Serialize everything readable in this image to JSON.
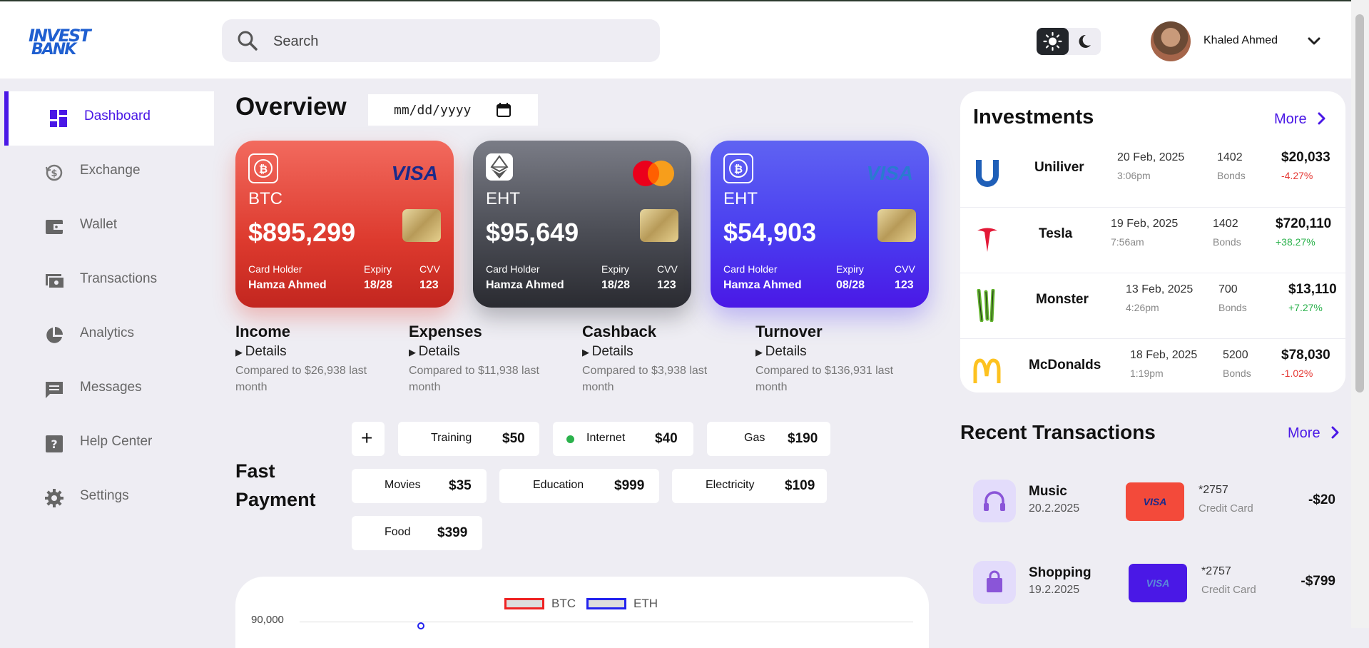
{
  "brand": {
    "logo_line1": "INVEST",
    "logo_line2": "BANK"
  },
  "search": {
    "placeholder": "Search"
  },
  "user": {
    "name": "Khaled Ahmed"
  },
  "sidebar": {
    "items": [
      {
        "label": "Dashboard",
        "icon": "dashboard-icon",
        "active": true
      },
      {
        "label": "Exchange",
        "icon": "exchange-icon"
      },
      {
        "label": "Wallet",
        "icon": "wallet-icon"
      },
      {
        "label": "Transactions",
        "icon": "transactions-icon"
      },
      {
        "label": "Analytics",
        "icon": "analytics-icon"
      },
      {
        "label": "Messages",
        "icon": "messages-icon"
      },
      {
        "label": "Help Center",
        "icon": "help-icon"
      },
      {
        "label": "Settings",
        "icon": "settings-icon"
      }
    ]
  },
  "overview": {
    "title": "Overview",
    "date_placeholder": "mm/dd/yyyy"
  },
  "cards": [
    {
      "coin": "BTC",
      "amount": "$895,299",
      "holder_label": "Card Holder",
      "holder": "Hamza Ahmed",
      "expiry_label": "Expiry",
      "expiry": "18/28",
      "cvv_label": "CVV",
      "cvv": "123",
      "network": "VISA"
    },
    {
      "coin": "EHT",
      "amount": "$95,649",
      "holder_label": "Card Holder",
      "holder": "Hamza Ahmed",
      "expiry_label": "Expiry",
      "expiry": "18/28",
      "cvv_label": "CVV",
      "cvv": "123",
      "network": "mastercard"
    },
    {
      "coin": "EHT",
      "amount": "$54,903",
      "holder_label": "Card Holder",
      "holder": "Hamza Ahmed",
      "expiry_label": "Expiry",
      "expiry": "08/28",
      "cvv_label": "CVV",
      "cvv": "123",
      "network": "VISA"
    }
  ],
  "stats": [
    {
      "title": "Income",
      "details": "Details",
      "compare": "Compared to $26,938 last month"
    },
    {
      "title": "Expenses",
      "details": "Details",
      "compare": "Compared to $11,938 last month"
    },
    {
      "title": "Cashback",
      "details": "Details",
      "compare": "Compared to $3,938 last month"
    },
    {
      "title": "Turnover",
      "details": "Details",
      "compare": "Compared to $136,931 last month"
    }
  ],
  "fast_payment": {
    "title_line1": "Fast",
    "title_line2": "Payment",
    "add_label": "+",
    "items": [
      {
        "label": "Training",
        "value": "$50"
      },
      {
        "label": "Internet",
        "value": "$40"
      },
      {
        "label": "Gas",
        "value": "$190"
      },
      {
        "label": "Movies",
        "value": "$35"
      },
      {
        "label": "Education",
        "value": "$999"
      },
      {
        "label": "Electricity",
        "value": "$109"
      },
      {
        "label": "Food",
        "value": "$399"
      }
    ]
  },
  "chart": {
    "legend": [
      "BTC",
      "ETH"
    ],
    "ytick_top": "90,000"
  },
  "chart_data": {
    "type": "line",
    "series": [
      {
        "name": "BTC",
        "values": []
      },
      {
        "name": "ETH",
        "values": []
      }
    ],
    "ylim_top_tick": 90000
  },
  "investments": {
    "title": "Investments",
    "more": "More",
    "rows": [
      {
        "name": "Uniliver",
        "date": "20 Feb, 2025",
        "time": "3:06pm",
        "qty": "1402",
        "unit": "Bonds",
        "value": "$20,033",
        "change": "-4.27%",
        "positive": false
      },
      {
        "name": "Tesla",
        "date": "19 Feb, 2025",
        "time": "7:56am",
        "qty": "1402",
        "unit": "Bonds",
        "value": "$720,110",
        "change": "+38.27%",
        "positive": true
      },
      {
        "name": "Monster",
        "date": "13 Feb, 2025",
        "time": "4:26pm",
        "qty": "700",
        "unit": "Bonds",
        "value": "$13,110",
        "change": "+7.27%",
        "positive": true
      },
      {
        "name": "McDonalds",
        "date": "18 Feb, 2025",
        "time": "1:19pm",
        "qty": "5200",
        "unit": "Bonds",
        "value": "$78,030",
        "change": "-1.02%",
        "positive": false
      }
    ]
  },
  "recent": {
    "title": "Recent Transactions",
    "more": "More",
    "rows": [
      {
        "name": "Music",
        "date": "20.2.2025",
        "card": "VISA",
        "number": "*2757",
        "type": "Credit Card",
        "amount": "-$20"
      },
      {
        "name": "Shopping",
        "date": "19.2.2025",
        "card": "VISA",
        "number": "*2757",
        "type": "Credit Card",
        "amount": "-$799"
      }
    ]
  },
  "colors": {
    "accent": "#4a18e6",
    "negative": "#e53935",
    "positive": "#2bb24c"
  }
}
